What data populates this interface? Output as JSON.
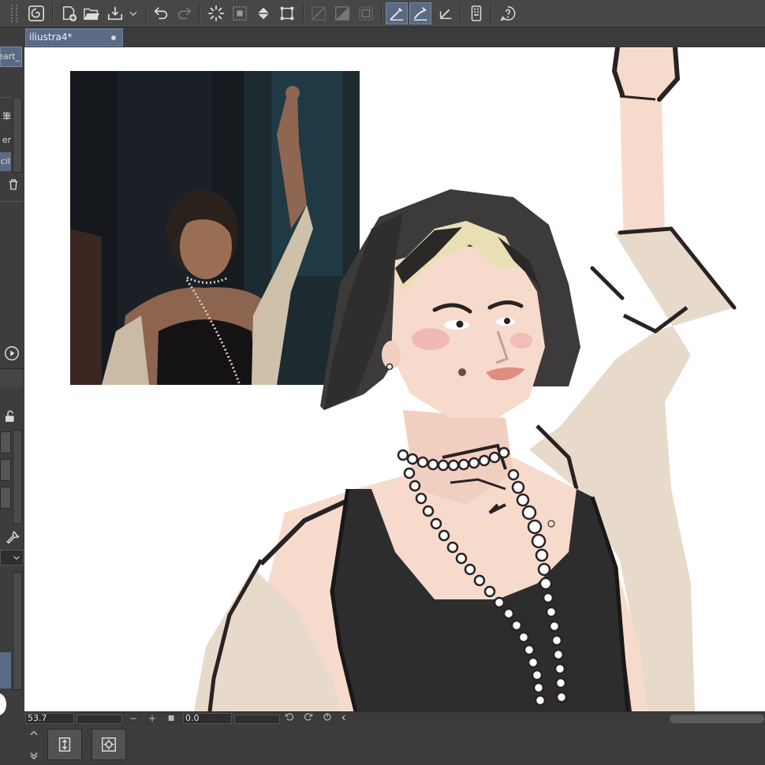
{
  "document": {
    "tab_title": "iliustra4*"
  },
  "left_panel": {
    "brush_label": "eart_",
    "sub_tool_1": "筆",
    "sub_tool_2": "er",
    "sub_tool_3": "cil"
  },
  "status_bar": {
    "zoom": "53.7",
    "rotation": "0.0",
    "zoom_out": "−",
    "zoom_in": "+",
    "fit": "■"
  },
  "colors": {
    "toolbar_bg": "#474747",
    "active_tool": "#5b6a84",
    "doc_tab": "#5d6a85",
    "canvas": "#ffffff",
    "skin": "#f5d9cc",
    "hair": "#3c3a3a",
    "shirt": "#e8dccd",
    "top": "#2e2d2e"
  },
  "toolbar_icons": [
    "app-logo-icon",
    "new-file-icon",
    "open-folder-icon",
    "save-icon",
    "dropdown-chevron-icon",
    "undo-icon",
    "redo-icon",
    "select-loading-icon",
    "selection-grid-icon",
    "fill-bucket-icon",
    "transform-icon",
    "deselect-icon",
    "invert-selection-icon",
    "selection-border-icon",
    "snap-ruler-icon",
    "snap-special-ruler-icon",
    "snap-grid-icon",
    "device-icon",
    "help-icon"
  ]
}
